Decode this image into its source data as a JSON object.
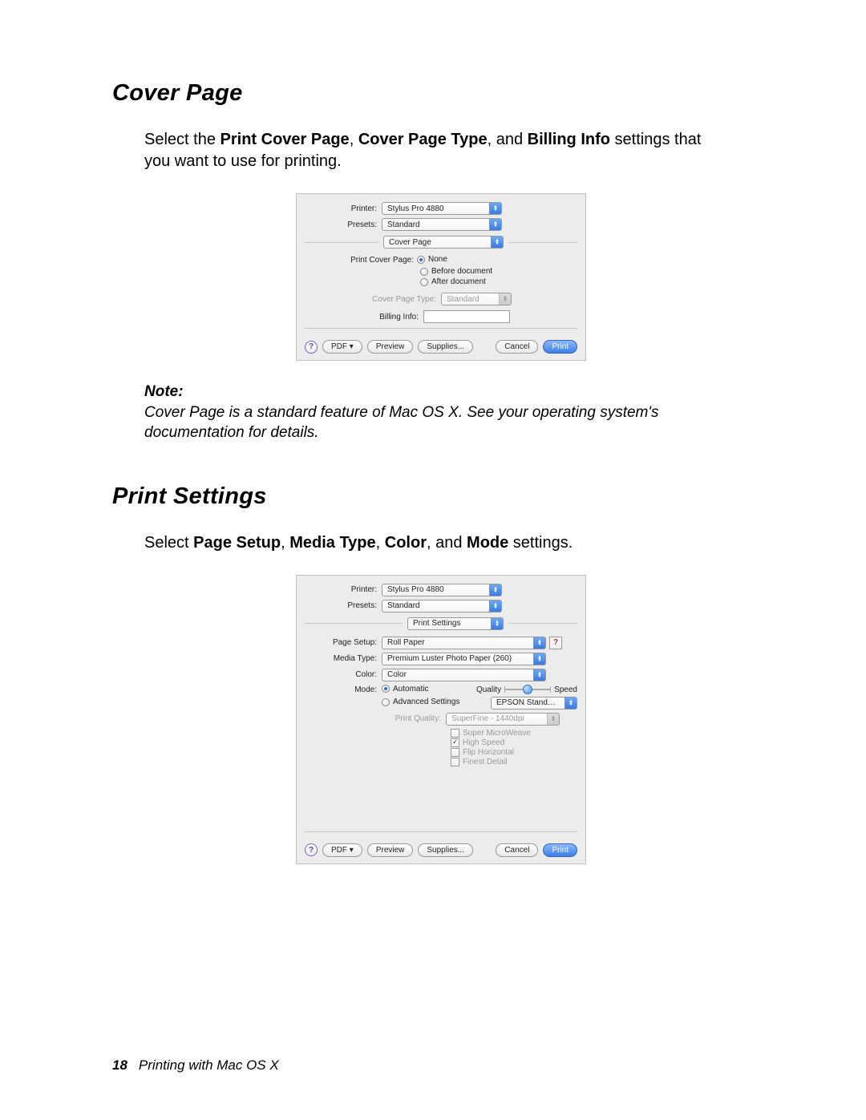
{
  "sections": {
    "cover_page": {
      "heading": "Cover Page",
      "intro_prefix": "Select the ",
      "bold1": "Print Cover Page",
      "sep1": ", ",
      "bold2": "Cover Page Type",
      "sep2": ", and ",
      "bold3": "Billing Info",
      "intro_suffix": " settings that you want to use for printing.",
      "note_label": "Note:",
      "note_text": "Cover Page is a standard feature of Mac OS X. See your operating system's documentation for details."
    },
    "print_settings": {
      "heading": "Print Settings",
      "intro_prefix": "Select ",
      "bold1": "Page Setup",
      "sep1": ", ",
      "bold2": "Media Type",
      "sep2": ", ",
      "bold3": "Color",
      "sep3": ", and ",
      "bold4": "Mode",
      "intro_suffix": " settings."
    }
  },
  "dialog1": {
    "printer_label": "Printer:",
    "printer_value": "Stylus Pro 4880",
    "presets_label": "Presets:",
    "presets_value": "Standard",
    "panel_value": "Cover Page",
    "pcp_label": "Print Cover Page:",
    "radio_none": "None",
    "radio_before": "Before document",
    "radio_after": "After document",
    "cpt_label": "Cover Page Type:",
    "cpt_value": "Standard",
    "billing_label": "Billing Info:",
    "help": "?",
    "pdf": "PDF ▾",
    "preview": "Preview",
    "supplies": "Supplies...",
    "cancel": "Cancel",
    "print": "Print"
  },
  "dialog2": {
    "printer_label": "Printer:",
    "printer_value": "Stylus Pro 4880",
    "presets_label": "Presets:",
    "presets_value": "Standard",
    "panel_value": "Print Settings",
    "page_setup_label": "Page Setup:",
    "page_setup_value": "Roll Paper",
    "media_type_label": "Media Type:",
    "media_type_value": "Premium Luster Photo Paper (260)",
    "color_label": "Color:",
    "color_value": "Color",
    "mode_label": "Mode:",
    "radio_auto": "Automatic",
    "radio_adv": "Advanced Settings",
    "quality_label": "Quality",
    "speed_label": "Speed",
    "epson_std": "EPSON Standard(...",
    "pq_label": "Print Quality:",
    "pq_value": "SuperFine - 1440dpi",
    "chk_smw": "Super MicroWeave",
    "chk_hs": "High Speed",
    "chk_fh": "Flip Horizontal",
    "chk_fd": "Finest Detail",
    "help": "?",
    "help2": "?",
    "pdf": "PDF ▾",
    "preview": "Preview",
    "supplies": "Supplies...",
    "cancel": "Cancel",
    "print": "Print"
  },
  "footer": {
    "page_num": "18",
    "text": "Printing with Mac OS X"
  }
}
